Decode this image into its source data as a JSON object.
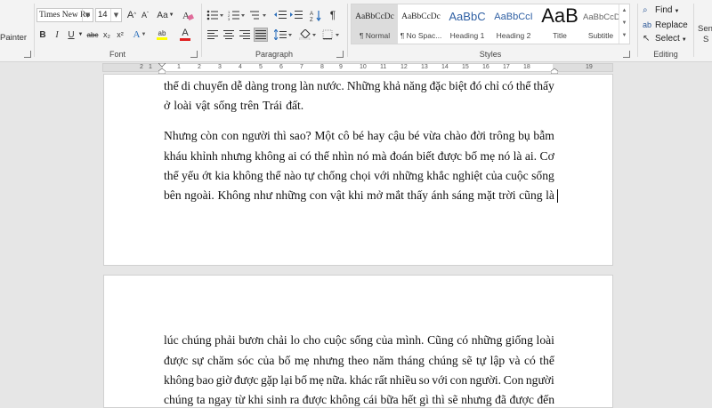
{
  "ribbon": {
    "clipboard": {
      "painter_label": "Painter"
    },
    "font": {
      "group_label": "Font",
      "font_name": "Times New Ro",
      "font_size": "14",
      "grow": "A",
      "shrink": "A",
      "case": "Aa",
      "bold": "B",
      "italic": "I",
      "underline": "U",
      "strike": "abc",
      "subscript": "x₂",
      "superscript": "x²",
      "text_effect": "A",
      "highlight": "ab",
      "font_color": "A",
      "highlight_color": "#ffff00",
      "font_color_value": "#e02020"
    },
    "paragraph": {
      "group_label": "Paragraph",
      "pilcrow": "¶"
    },
    "styles": {
      "group_label": "Styles",
      "items": [
        {
          "preview": "AaBbCcDc",
          "name": "¶ Normal"
        },
        {
          "preview": "AaBbCcDc",
          "name": "¶ No Spac..."
        },
        {
          "preview": "AaBbC",
          "name": "Heading 1"
        },
        {
          "preview": "AaBbCcI",
          "name": "Heading 2"
        },
        {
          "preview": "AaB",
          "name": "Title"
        },
        {
          "preview": "AaBbCcDc",
          "name": "Subtitle"
        }
      ]
    },
    "editing": {
      "group_label": "Editing",
      "find": "Find",
      "replace": "Replace",
      "select": "Select"
    },
    "partial": {
      "sen_top": "Sen",
      "sen_bottom": "S"
    }
  },
  "ruler": {
    "ticks": [
      "2",
      "1",
      "1",
      "2",
      "3",
      "4",
      "5",
      "6",
      "7",
      "8",
      "9",
      "10",
      "11",
      "12",
      "13",
      "14",
      "15",
      "16",
      "17",
      "18",
      "19"
    ]
  },
  "document": {
    "page1_lines": [
      "thể di chuyển dễ dàng trong làn nước. Những khả năng đặc biệt đó chỉ có thể thấy",
      "ở loài vật sống trên Trái đất.",
      "Nhưng còn con người thì sao? Một cô bé hay cậu bé vừa chào đời trông bụ bẫm",
      "kháu khỉnh nhưng không ai có thể nhìn nó mà đoán biết được bố mẹ nó là ai. Cơ",
      "thể yếu ớt kia không thể nào tự chống chọi với những khắc nghiệt của cuộc sống",
      "bên ngoài. Không như những con vật khi mở mắt thấy ánh sáng mặt trời cũng là"
    ],
    "page2_lines": [
      "lúc chúng phải bươn chải lo cho cuộc sống của mình. Cũng có những giống loài",
      "được sự chăm sóc của bố mẹ nhưng theo năm tháng chúng sẽ tự lập và có thể",
      "không bao giờ được gặp lại bố mẹ nữa. khác rất nhiều so với con người. Con người",
      "chúng ta ngay từ khi sinh ra được không cái bữa hết gì thì sẽ nhưng đã được đến"
    ]
  }
}
